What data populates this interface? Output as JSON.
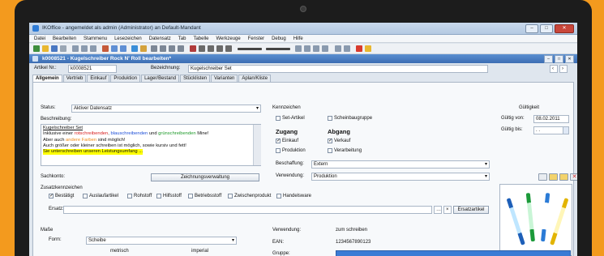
{
  "window": {
    "title": "IKOffice - angemeldet als admin (Administrator) an Default-Mandant"
  },
  "menu": [
    "Datei",
    "Bearbeiten",
    "Stammenu",
    "Lesezeichen",
    "Datensatz",
    "Tab",
    "Tabelle",
    "Werkzeuge",
    "Fenster",
    "Debug",
    "Hilfe"
  ],
  "document": {
    "title": "k0008521 - Kugelschreiber Rock N' Roll bearbeiten*"
  },
  "header": {
    "artikel_label": "Artikel Nr.:",
    "artikel_value": "k0008521",
    "bezeichnung_label": "Bezeichnung:",
    "bezeichnung_value": "Kugelschreiber Set"
  },
  "tabs": [
    "Allgemein",
    "Vertrieb",
    "Einkauf",
    "Produktion",
    "Lager/Bestand",
    "Stücklisten",
    "Varianten",
    "Aplan/Kliste"
  ],
  "status": {
    "label": "Status:",
    "value": "Aktiver Datensatz"
  },
  "beschreibung": {
    "label": "Beschreibung:",
    "line1": "Kugelschreiber Set",
    "line2_a": "Inklusive einer ",
    "line2_red": "rotschreibenden",
    "line2_b": ", ",
    "line2_blue": "blauschreibenden",
    "line2_c": " und ",
    "line2_green": "grünschreibenden",
    "line2_d": " Mine!",
    "line3_a": "Aber auch ",
    "line3_orange": "andere Farben",
    "line3_b": " sind möglich!",
    "line4": "Auch größer oder kleiner schreiben ist möglich, sowie kursiv und fett!",
    "line5": "Sie unterschreiben unseren Leistungsumfang ..."
  },
  "sachkonto": {
    "label": "Sachkonto:",
    "button": "Zeichnungsverwaltung"
  },
  "zusatzkennzeichen": {
    "label": "Zusatzkennzeichen",
    "items": [
      {
        "label": "Bestätigt",
        "checked": true
      },
      {
        "label": "Auslaufartikel",
        "checked": false
      },
      {
        "label": "Rohstoff",
        "checked": false
      },
      {
        "label": "Hilfsstoff",
        "checked": false
      },
      {
        "label": "Betriebsstoff",
        "checked": false
      },
      {
        "label": "Zwischenprodukt",
        "checked": false
      },
      {
        "label": "Handelsware",
        "checked": false
      }
    ],
    "ersatz_label": "Ersatz:",
    "ersatz_button": "Ersatzartikel"
  },
  "kennzeichen": {
    "label": "Kennzeichen",
    "set_artikel": "Set-Artikel",
    "scheinbaugruppe": "Scheinbaugruppe",
    "zugang": "Zugang",
    "abgang": "Abgang",
    "einkauf": "Einkauf",
    "verkauf": "Verkauf",
    "produktion": "Produktion",
    "verarbeitung": "Verarbeitung",
    "beschaffung_label": "Beschaffung:",
    "beschaffung_value": "Extern",
    "verwendung_label": "Verwendung:",
    "verwendung_value": "Produktion"
  },
  "gueltigkeit": {
    "label": "Gültigkeit",
    "von_label": "Gültig von:",
    "von_value": "08.02.2011",
    "bis_label": "Gültig bis:",
    "bis_value": ". ."
  },
  "masse": {
    "label": "Maße",
    "form_label": "Form:",
    "form_value": "Scheibe",
    "metrisch": "metrisch",
    "imperial": "imperial"
  },
  "bottom": {
    "verwendung_label": "Verwendung:",
    "verwendung_value": "zum schreiben",
    "ean_label": "EAN:",
    "ean_value": "1234567890123",
    "gruppe_label": "Gruppe:"
  },
  "colors": {
    "accent": "#f39a1e",
    "title": "#3c6db3"
  }
}
